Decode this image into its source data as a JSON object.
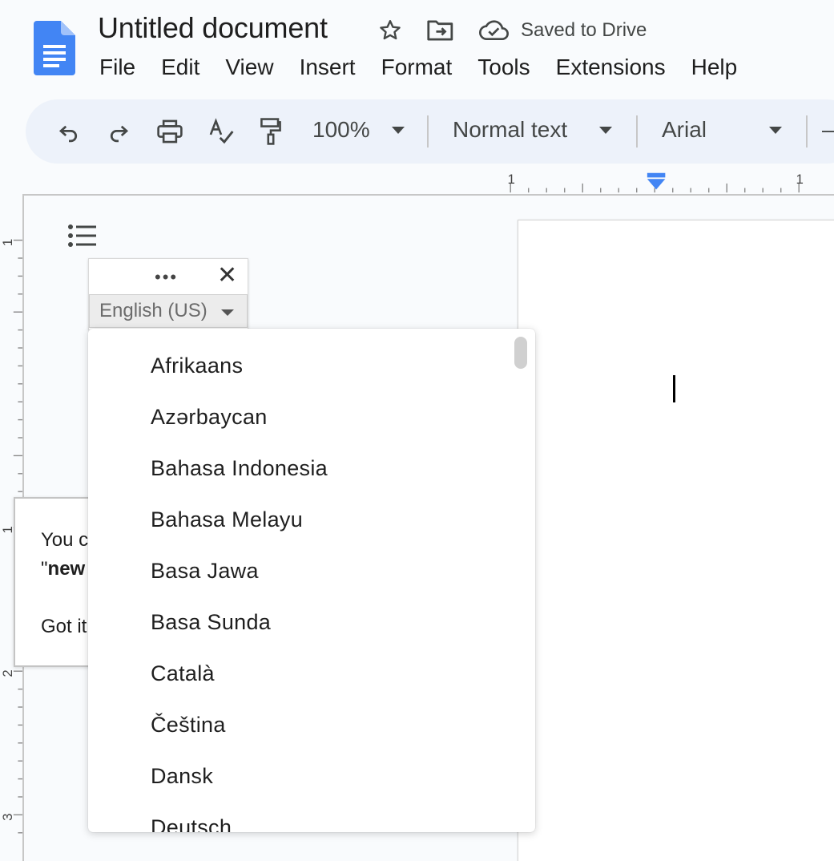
{
  "header": {
    "title": "Untitled document",
    "saved_status": "Saved to Drive",
    "icons": [
      "docs-logo-icon",
      "star-icon",
      "move-folder-icon",
      "cloud-saved-icon"
    ]
  },
  "menubar": {
    "items": [
      "File",
      "Edit",
      "View",
      "Insert",
      "Format",
      "Tools",
      "Extensions",
      "Help"
    ]
  },
  "toolbar": {
    "zoom": "100%",
    "style": "Normal text",
    "font": "Arial",
    "icons": [
      "undo-icon",
      "redo-icon",
      "print-icon",
      "spellcheck-icon",
      "paint-format-icon"
    ],
    "overflow_glyph": "–"
  },
  "ruler": {
    "top_labels": [
      "1",
      "1"
    ],
    "left_labels": [
      "1",
      "1",
      "2",
      "3"
    ]
  },
  "widget": {
    "dots": "•••",
    "close": "✕",
    "selected_language": "English (US)"
  },
  "tooltip": {
    "line1": "You c",
    "line2_prefix": "\"",
    "line2_bold": "new",
    "got_it": "Got it"
  },
  "language_dropdown": {
    "options": [
      "Afrikaans",
      "Azərbaycan",
      "Bahasa Indonesia",
      "Bahasa Melayu",
      "Basa Jawa",
      "Basa Sunda",
      "Català",
      "Čeština",
      "Dansk",
      "Deutsch"
    ]
  },
  "colors": {
    "docs_blue": "#4285f4",
    "toolbar_bg": "#edf2fa",
    "indent_marker": "#4285f4"
  }
}
